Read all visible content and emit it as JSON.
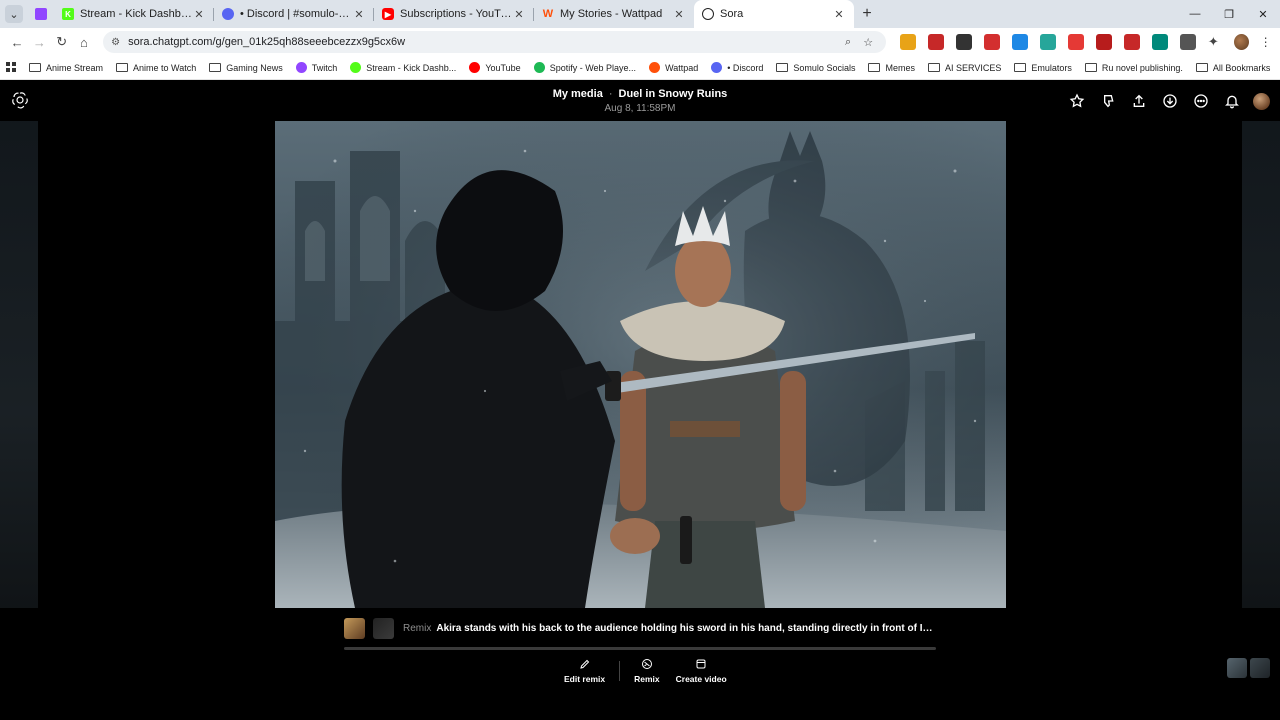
{
  "browser": {
    "tabs": [
      {
        "title": "",
        "favicon_color": "#9146ff",
        "active": false,
        "pinned": true
      },
      {
        "title": "Stream - Kick Dashboard",
        "favicon_color": "#53fc18",
        "active": false
      },
      {
        "title": "• Discord | #somulo-workshop",
        "favicon_color": "#5865f2",
        "active": false
      },
      {
        "title": "Subscriptions - YouTube",
        "favicon_color": "#ff0000",
        "active": false
      },
      {
        "title": "My Stories - Wattpad",
        "favicon_color": "#ff500a",
        "active": false
      },
      {
        "title": "Sora",
        "favicon_color": "#222222",
        "active": true
      }
    ],
    "url": "sora.chatgpt.com/g/gen_01k25qh88seeebcezzx9g5cx6w",
    "bookmarks": [
      {
        "label": "Anime Stream",
        "kind": "folder"
      },
      {
        "label": "Anime to Watch",
        "kind": "folder"
      },
      {
        "label": "Gaming News",
        "kind": "folder"
      },
      {
        "label": "Twitch",
        "kind": "site",
        "color": "#9146ff"
      },
      {
        "label": "Stream - Kick Dashb...",
        "kind": "site",
        "color": "#53fc18"
      },
      {
        "label": "YouTube",
        "kind": "site",
        "color": "#ff0000"
      },
      {
        "label": "Spotify - Web Playe...",
        "kind": "site",
        "color": "#1db954"
      },
      {
        "label": "Wattpad",
        "kind": "site",
        "color": "#ff500a"
      },
      {
        "label": "• Discord",
        "kind": "site",
        "color": "#5865f2"
      },
      {
        "label": "Somulo Socials",
        "kind": "folder"
      },
      {
        "label": "Memes",
        "kind": "folder"
      },
      {
        "label": "AI SERVICES",
        "kind": "folder"
      },
      {
        "label": "Emulators",
        "kind": "folder"
      },
      {
        "label": "Ru novel publishing.",
        "kind": "folder"
      }
    ],
    "all_bookmarks": "All Bookmarks",
    "extension_colors": [
      "#e8a317",
      "#c62828",
      "#333333",
      "#d32f2f",
      "#1e88e5",
      "#26a69a",
      "#e53935",
      "#b71c1c",
      "#c62828",
      "#00897b",
      "#555555"
    ]
  },
  "sora": {
    "breadcrumb_root": "My media",
    "breadcrumb_sep": "·",
    "title": "Duel in Snowy Ruins",
    "timestamp": "Aug 8, 11:58PM",
    "remix_tag": "Remix",
    "prompt": "Akira stands with his back to the audience holding his sword in his hand, standing directly in front of Igor (his opponent)...",
    "actions": {
      "edit_remix": "Edit remix",
      "remix": "Remix",
      "create_video": "Create video"
    }
  }
}
